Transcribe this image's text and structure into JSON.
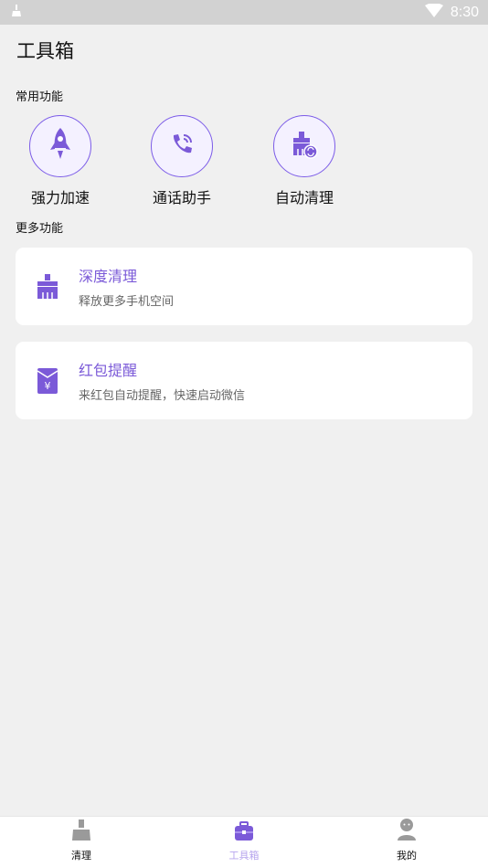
{
  "status_bar": {
    "time": "8:30"
  },
  "page_title": "工具箱",
  "sections": {
    "common": "常用功能",
    "more": "更多功能"
  },
  "quick_actions": [
    {
      "label": "强力加速",
      "icon": "rocket-icon"
    },
    {
      "label": "通话助手",
      "icon": "phone-call-icon"
    },
    {
      "label": "自动清理",
      "icon": "auto-clean-brush-icon"
    }
  ],
  "cards": [
    {
      "title": "深度清理",
      "subtitle": "释放更多手机空间",
      "icon": "broom-brush-icon"
    },
    {
      "title": "红包提醒",
      "subtitle": "来红包自动提醒，快速启动微信",
      "icon": "red-envelope-icon"
    }
  ],
  "tabs": [
    {
      "label": "清理",
      "icon": "broom-icon",
      "active": false
    },
    {
      "label": "工具箱",
      "icon": "toolbox-icon",
      "active": true
    },
    {
      "label": "我的",
      "icon": "user-icon",
      "active": false
    }
  ],
  "colors": {
    "accent": "#7b5ad8",
    "background": "#f0f0f0",
    "status_bar": "#d2d2d2",
    "active_tab_label": "#b7a5ee",
    "inactive_icon": "#9a9a9a"
  }
}
